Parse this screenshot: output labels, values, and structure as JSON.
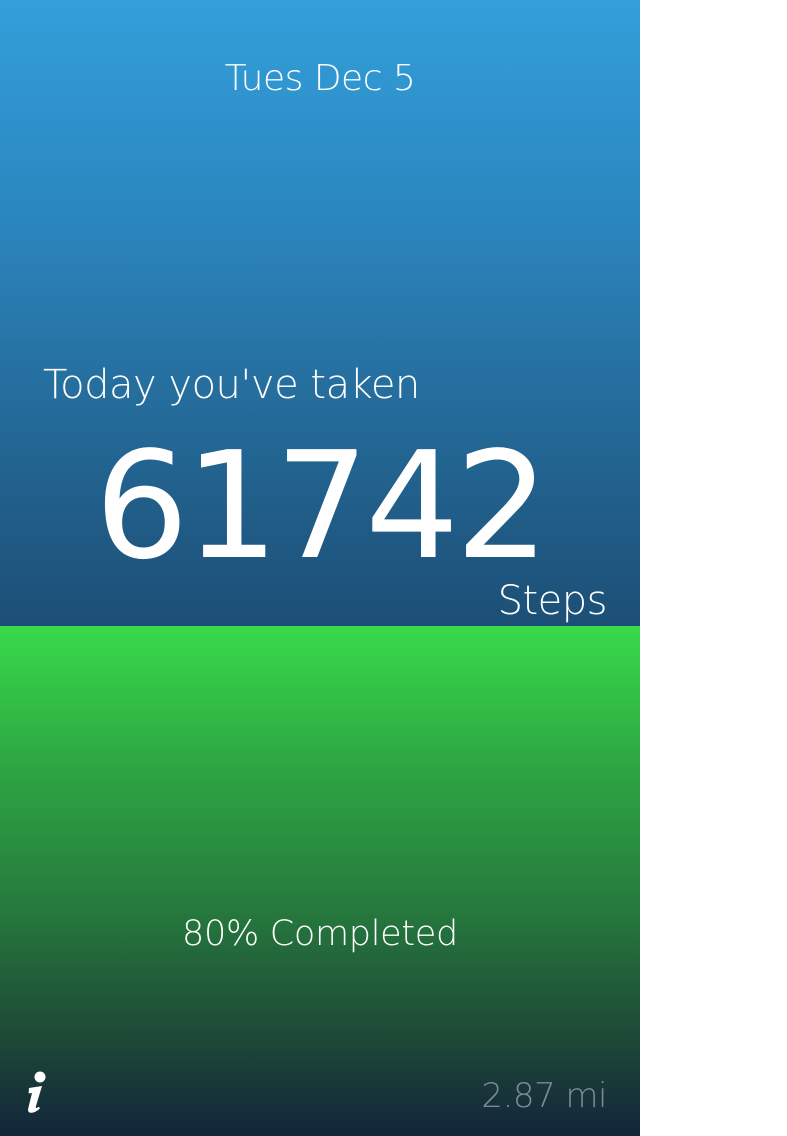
{
  "header": {
    "date": "Tues Dec 5"
  },
  "summary": {
    "intro": "Today you've taken",
    "steps": "61742",
    "unit": "Steps"
  },
  "progress": {
    "label": "80% Completed",
    "percent": 80
  },
  "footer": {
    "distance": "2.87 mi",
    "info_icon": "info-icon"
  },
  "colors": {
    "top_gradient_start": "#339fdb",
    "top_gradient_end": "#1c4f76",
    "bottom_gradient_start": "#38da4b",
    "bottom_gradient_end": "#13253a",
    "distance_text": "#7d8a99"
  }
}
